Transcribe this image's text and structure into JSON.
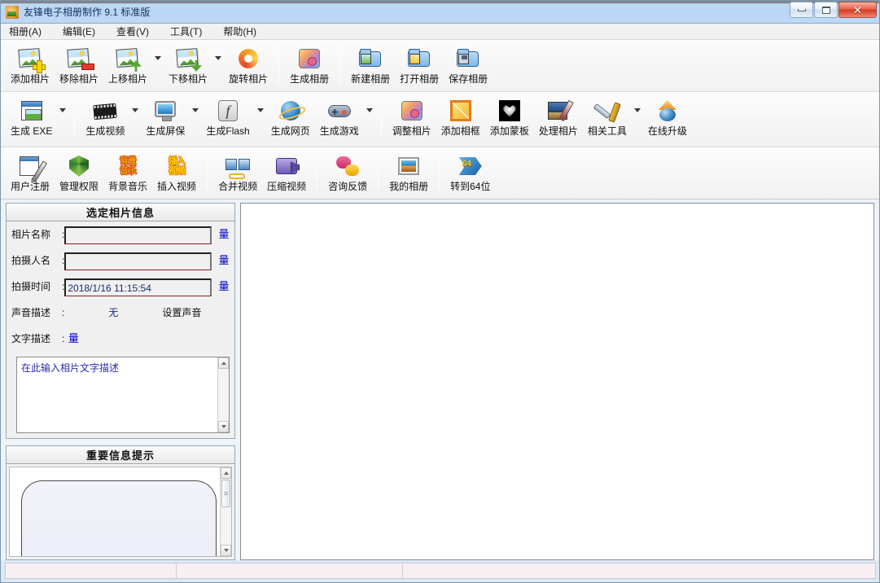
{
  "window": {
    "title": "友锋电子相册制作 9.1 标准版",
    "app_icon": "album-app-icon",
    "minimize_label": "最小化",
    "maximize_label": "最大化",
    "close_label": "关闭"
  },
  "menu": [
    {
      "label": "相册(A)"
    },
    {
      "label": "编辑(E)"
    },
    {
      "label": "查看(V)"
    },
    {
      "label": "工具(T)"
    },
    {
      "label": "帮助(H)"
    }
  ],
  "toolbar_row1": [
    {
      "label": "添加相片",
      "icon": "add-photo-icon",
      "dropdown": false
    },
    {
      "label": "移除相片",
      "icon": "remove-photo-icon",
      "dropdown": false
    },
    {
      "label": "上移相片",
      "icon": "move-up-photo-icon",
      "dropdown": true
    },
    {
      "label": "下移相片",
      "icon": "move-down-photo-icon",
      "dropdown": true
    },
    {
      "label": "旋转相片",
      "icon": "rotate-photo-icon",
      "dropdown": false
    },
    {
      "label": "生成相册",
      "icon": "build-album-icon",
      "dropdown": false
    },
    {
      "label": "新建相册",
      "icon": "new-album-icon",
      "dropdown": false
    },
    {
      "label": "打开相册",
      "icon": "open-album-icon",
      "dropdown": false
    },
    {
      "label": "保存相册",
      "icon": "save-album-icon",
      "dropdown": false
    }
  ],
  "toolbar_row2": [
    {
      "label": "生成 EXE",
      "icon": "build-exe-icon",
      "dropdown": true
    },
    {
      "label": "生成视频",
      "icon": "build-video-icon",
      "dropdown": true
    },
    {
      "label": "生成屏保",
      "icon": "build-screensaver-icon",
      "dropdown": true
    },
    {
      "label": "生成Flash",
      "icon": "build-flash-icon",
      "dropdown": true
    },
    {
      "label": "生成网页",
      "icon": "build-webpage-icon",
      "dropdown": false
    },
    {
      "label": "生成游戏",
      "icon": "build-game-icon",
      "dropdown": true
    },
    {
      "label": "调整相片",
      "icon": "adjust-photo-icon",
      "dropdown": false
    },
    {
      "label": "添加相框",
      "icon": "add-frame-icon",
      "dropdown": false
    },
    {
      "label": "添加蒙板",
      "icon": "add-mask-icon",
      "dropdown": false
    },
    {
      "label": "处理相片",
      "icon": "process-photo-icon",
      "dropdown": false
    },
    {
      "label": "相关工具",
      "icon": "related-tools-icon",
      "dropdown": true
    },
    {
      "label": "在线升级",
      "icon": "online-upgrade-icon",
      "dropdown": false
    }
  ],
  "toolbar_row3": [
    {
      "label": "用户注册",
      "icon": "user-register-icon",
      "dropdown": false
    },
    {
      "label": "管理权限",
      "icon": "manage-permission-icon",
      "dropdown": false
    },
    {
      "label": "背景音乐",
      "icon": "background-music-icon",
      "dropdown": false,
      "art_top": "背景",
      "art_bottom": "音乐"
    },
    {
      "label": "插入视频",
      "icon": "insert-video-icon",
      "dropdown": false,
      "art_top": "插入",
      "art_bottom": "视频"
    },
    {
      "label": "合并视频",
      "icon": "merge-video-icon",
      "dropdown": false
    },
    {
      "label": "压缩视频",
      "icon": "compress-video-icon",
      "dropdown": false
    },
    {
      "label": "咨询反馈",
      "icon": "feedback-icon",
      "dropdown": false
    },
    {
      "label": "我的相册",
      "icon": "my-album-icon",
      "dropdown": false
    },
    {
      "label": "转到64位",
      "icon": "switch-64bit-icon",
      "dropdown": false
    }
  ],
  "photo_info": {
    "title": "选定相片信息",
    "fields": [
      {
        "label": "相片名称",
        "value": "",
        "placeholder": "",
        "link": "量"
      },
      {
        "label": "拍摄人名",
        "value": "",
        "placeholder": "",
        "link": "量"
      },
      {
        "label": "拍摄时间",
        "value": "2018/1/16 11:15:54",
        "placeholder": "",
        "link": "量"
      }
    ],
    "sound": {
      "label": "声音描述",
      "value": "无",
      "action": "设置声音"
    },
    "description": {
      "label": "文字描述",
      "link": "量",
      "placeholder": "在此输入相片文字描述",
      "value": ""
    }
  },
  "tips_panel": {
    "title": "重要信息提示",
    "content": ""
  },
  "statusbar": {
    "cells": [
      "",
      "",
      ""
    ]
  },
  "colors": {
    "titlebar": "#bcd8f6",
    "link": "#0000cc",
    "field_underline": "#8a2020",
    "field_text": "#1a2a6c",
    "toolbar_bg": "#f3f3f3",
    "close_button": "#d23a22"
  }
}
